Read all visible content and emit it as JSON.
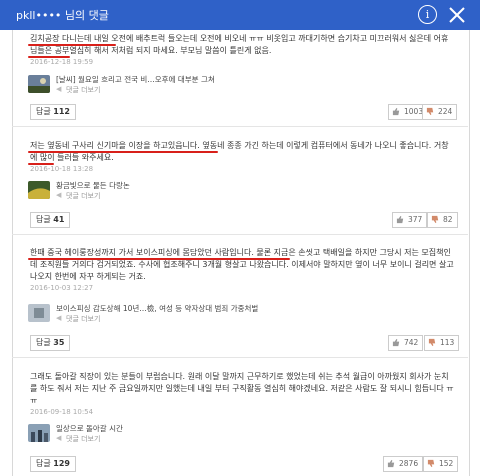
{
  "header": {
    "title": "pkll•••• 님의 댓글"
  },
  "comments": [
    {
      "text": "김치공장 다니는데 내일 오전에 배추트럭 들오는데 오전에 비오네 ㅠㅠ 비옷입고 까대기하면 습기차고 미끄러워서 싫은데 어휴 님들은 공부열심히 해서 저처럼 되지 마세요. 부모님 말씀이 틀린게 없음.",
      "date": "2016-12-18 19:59",
      "reply": {
        "text": "[날씨] 월요일 흐리고 전국 비…오후에 대부분 그쳐",
        "more": "댓글 더보기"
      },
      "reply_count_label": "답글",
      "reply_count": "112",
      "likes": "1003",
      "dislikes": "224"
    },
    {
      "text": "저는 옆동네 구사리 신기마을 이장을 하고있읍니다. 옆동네 종종 가긴 하는데 이렇게 컴퓨터에서 동네가 나오니 좋습니다. 거창에 많이 들러들 와주세요.",
      "date": "2016-10-18 13:28",
      "reply": {
        "text": "황금빛으로 물든 다랑논",
        "more": "댓글 더보기"
      },
      "reply_count_label": "답글",
      "reply_count": "41",
      "likes": "377",
      "dislikes": "82"
    },
    {
      "text": "한때 중국 헤이룽장성까지 가서 보이스피싱에 몸담았던 사람입니다. 물론 지금은 손씻고 택배일을 하지만 그당시 저는 모집책인데 조직원들 거의다 검거되었죠. 수사에 협조해주니 3개월 형살고 나왔습니다. 이제서야 말하지만 옆이 너무 보이니 걸리면 살고 나오지 한번에 자꾸 하게되는 거죠.",
      "date": "2016-10-03 12:27",
      "reply": {
        "text": "보이스피싱 감도상해 10년…檢, 여성 등 약자상대 범죄 가중처벌",
        "more": "댓글 더보기"
      },
      "reply_count_label": "답글",
      "reply_count": "35",
      "likes": "742",
      "dislikes": "113"
    },
    {
      "text": "그래도 돌아갈 직장이 있는 분들이 부럽습니다. 원래 이달 말까지 근무하기로 했었는데 쉬는 추석 월급이 아까웠지 회사가 눈치를 하도 줘서 저는 지난 주 금요일까지만 일했는데 내일 부터 구직활동 열심히 해야겠네요. 저같은 사람도 잘 되시니 힘듭니다 ㅠㅠ",
      "date": "2016-09-18 10:54",
      "reply": {
        "text": "일상으로 돌아갈 시간",
        "more": "댓글 더보기"
      },
      "reply_count_label": "답글",
      "reply_count": "129",
      "likes": "2876",
      "dislikes": "152"
    }
  ],
  "colors": {
    "header_bg": "#2f61c8",
    "highlight": "#d8201a"
  }
}
